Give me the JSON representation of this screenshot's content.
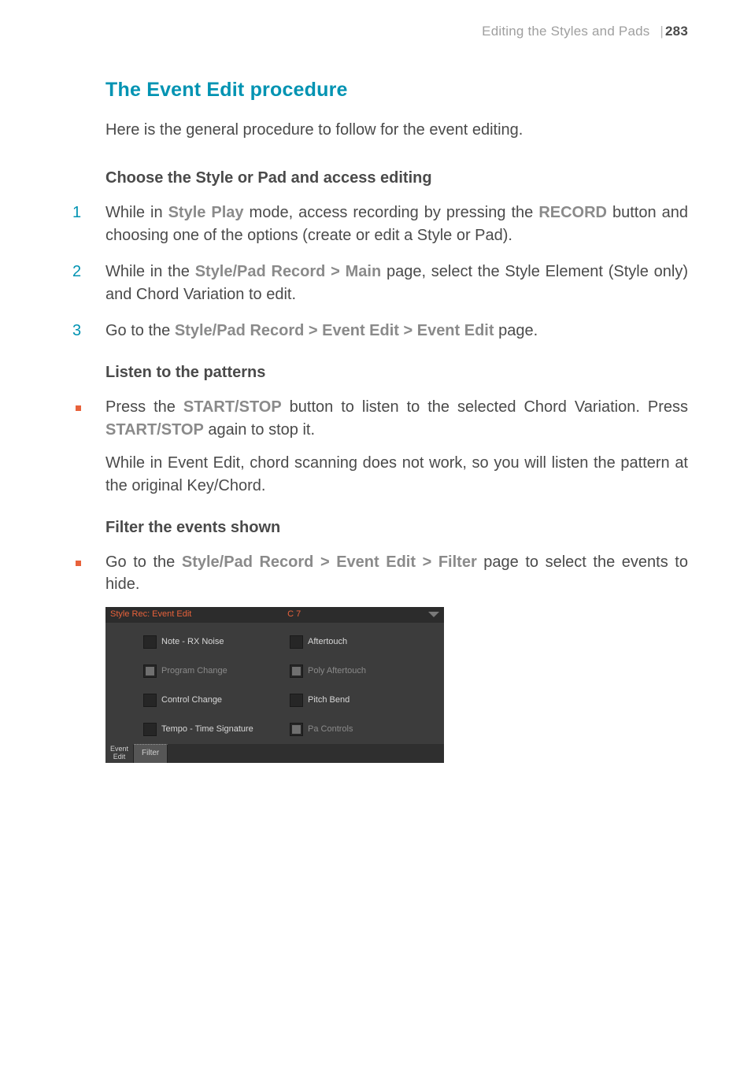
{
  "header": {
    "chapter": "Editing the Styles and Pads",
    "separator": "|",
    "page_number": "283"
  },
  "section_title": "The Event Edit procedure",
  "intro_text": "Here is the general procedure to follow for the event editing.",
  "group1": {
    "heading": "Choose the Style or Pad and access editing",
    "step1_a": "While in ",
    "step1_ref1": "Style Play",
    "step1_b": " mode, access recording by pressing the ",
    "step1_ref2": "RECORD",
    "step1_c": " button and choosing one of the options (create or edit a Style or Pad).",
    "step2_a": "While in the ",
    "step2_ref1": "Style/Pad Record > Main",
    "step2_b": " page, select the Style Element (Style only) and Chord Variation to edit.",
    "step3_a": "Go to the ",
    "step3_ref1": "Style/Pad Record > Event Edit > Event Edit",
    "step3_b": " page."
  },
  "group2": {
    "heading": "Listen to the patterns",
    "bullet1_a": "Press the ",
    "bullet1_ref1": "START/STOP",
    "bullet1_b": " button to listen to the selected Chord Variation. Press ",
    "bullet1_ref2": "START/STOP",
    "bullet1_c": " again to stop it.",
    "cont": "While in Event Edit, chord scanning does not work, so you will listen the pattern at the original Key/Chord."
  },
  "group3": {
    "heading": "Filter the events shown",
    "bullet1_a": "Go to the ",
    "bullet1_ref1": "Style/Pad Record > Event Edit > Filter",
    "bullet1_b": " page to select the events to hide."
  },
  "screen": {
    "title_left": "Style Rec: Event Edit",
    "title_center": "C 7",
    "filters": {
      "note": "Note - RX Noise",
      "aftertouch": "Aftertouch",
      "program_change": "Program Change",
      "poly_aftertouch": "Poly Aftertouch",
      "control_change": "Control Change",
      "pitch_bend": "Pitch Bend",
      "tempo_time_sig": "Tempo - Time Signature",
      "pa_controls": "Pa Controls"
    },
    "tabs": {
      "event_edit_line1": "Event",
      "event_edit_line2": "Edit",
      "filter": "Filter"
    }
  }
}
